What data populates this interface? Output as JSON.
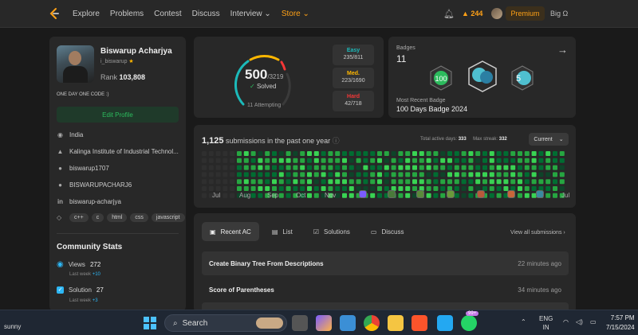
{
  "nav": {
    "items": [
      "Explore",
      "Problems",
      "Contest",
      "Discuss",
      "Interview ⌄",
      "Store ⌄"
    ],
    "streak": "244",
    "premium": "Premium",
    "right_text": "Big Ω"
  },
  "profile": {
    "name": "Biswarup Acharjya",
    "username": "i_biswarup",
    "rank_label": "Rank",
    "rank": "103,808",
    "motto": "ONE DAY ONE CODE :)",
    "edit_label": "Edit Profile",
    "location": "India",
    "school": "Kalinga Institute of Industrial Technol...",
    "github": "biswarup1707",
    "leetcode": "BISWARUPACHARJ6",
    "linkedin": "biswarup-acharjya",
    "skills": [
      "c++",
      "c",
      "html",
      "css",
      "javascript"
    ]
  },
  "community": {
    "title": "Community Stats",
    "views_label": "Views",
    "views": "272",
    "views_week": "+10",
    "solution_label": "Solution",
    "solution": "27",
    "solution_week": "+3",
    "last_week": "Last week"
  },
  "solved": {
    "count": "500",
    "total": "/3219",
    "label": "Solved",
    "attempting": "11 Attempting",
    "easy": {
      "label": "Easy",
      "value": "235/811",
      "color": "#1cbaba"
    },
    "medium": {
      "label": "Med.",
      "value": "223/1690",
      "color": "#ffb700"
    },
    "hard": {
      "label": "Hard",
      "value": "42/718",
      "color": "#f63737"
    }
  },
  "badges": {
    "label": "Badges",
    "count": "11",
    "recent_label": "Most Recent Badge",
    "recent_name": "100 Days Badge 2024"
  },
  "heatmap": {
    "count": "1,125",
    "title": "submissions in the past one year",
    "active_label": "Total active days:",
    "active": "333",
    "streak_label": "Max streak:",
    "streak": "332",
    "dropdown": "Current",
    "months": [
      "Jul",
      "Aug",
      "Sep",
      "Oct",
      "Nov",
      "",
      "",
      "",
      "",
      "",
      "",
      "",
      "Jul"
    ]
  },
  "recent": {
    "tabs": [
      "Recent AC",
      "List",
      "Solutions",
      "Discuss"
    ],
    "view_all": "View all submissions ›",
    "rows": [
      {
        "title": "Create Binary Tree From Descriptions",
        "ago": "22 minutes ago"
      },
      {
        "title": "Score of Parentheses",
        "ago": "34 minutes ago"
      }
    ]
  },
  "taskbar": {
    "weather": "sunny",
    "search": "Search",
    "lang1": "ENG",
    "lang2": "IN",
    "time": "7:57 PM",
    "date": "7/15/2024",
    "badge": "99+"
  }
}
